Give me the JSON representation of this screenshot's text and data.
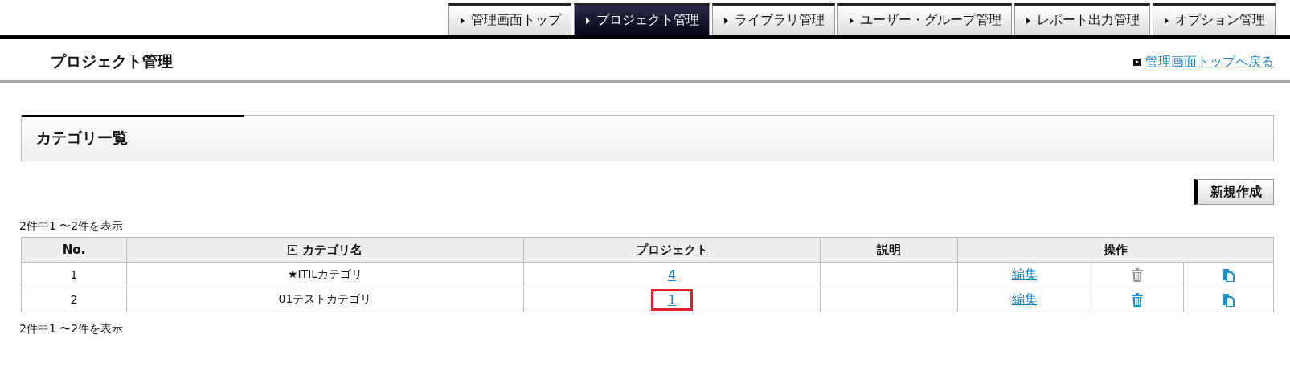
{
  "tabs": [
    {
      "label": "管理画面トップ",
      "selected": false
    },
    {
      "label": "プロジェクト管理",
      "selected": true
    },
    {
      "label": "ライブラリ管理",
      "selected": false
    },
    {
      "label": "ユーザー・グループ管理",
      "selected": false
    },
    {
      "label": "レポート出力管理",
      "selected": false
    },
    {
      "label": "オプション管理",
      "selected": false
    }
  ],
  "page_title": "プロジェクト管理",
  "back_link": "管理画面トップへ戻る",
  "panel_title": "カテゴリー覧",
  "new_button": "新規作成",
  "count_top": "2件中1 〜2件を表示",
  "table": {
    "columns": [
      {
        "label": "No.",
        "kind": "plain"
      },
      {
        "label": "カテゴリ名",
        "kind": "sorted"
      },
      {
        "label": "プロジェクト",
        "kind": "link"
      },
      {
        "label": "説明",
        "kind": "link"
      },
      {
        "label": "操作",
        "kind": "plain"
      }
    ],
    "rows": [
      {
        "no": "1",
        "name": "★ITILカテゴリ",
        "projects": "4",
        "projects_highlighted": false,
        "edit": "編集",
        "delete_disabled": true
      },
      {
        "no": "2",
        "name": "01テストカテゴリ",
        "projects": "1",
        "projects_highlighted": true,
        "edit": "編集",
        "delete_disabled": false
      }
    ]
  },
  "count_bottom": "2件中1 〜2件を表示"
}
